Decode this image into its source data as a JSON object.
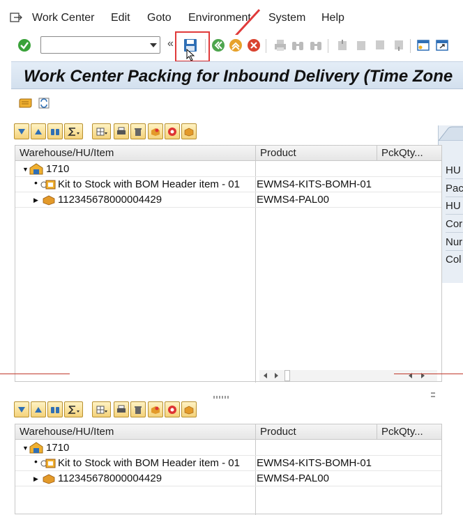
{
  "menu": {
    "items": [
      "Work Center",
      "Edit",
      "Goto",
      "Environment",
      "System",
      "Help"
    ]
  },
  "toolbar": {
    "command_field_value": "",
    "collapse_glyph": "«"
  },
  "title": "Work Center Packing for Inbound Delivery (Time Zone",
  "grid_columns": {
    "col1": "Warehouse/HU/Item",
    "col2": "Product",
    "col3": "PckQty...",
    "col3_bottom": "PckQty..."
  },
  "top_grid": {
    "rows": [
      {
        "name": "1710",
        "product": ""
      },
      {
        "name": "Kit to Stock with BOM Header item - 01",
        "product": "EWMS4-KITS-BOMH-01"
      },
      {
        "name": "112345678000004429",
        "product": "EWMS4-PAL00"
      }
    ]
  },
  "bottom_grid": {
    "rows": [
      {
        "name": "1710",
        "product": ""
      },
      {
        "name": "Kit to Stock with BOM Header item - 01",
        "product": "EWMS4-KITS-BOMH-01"
      },
      {
        "name": "112345678000004429",
        "product": "EWMS4-PAL00"
      }
    ]
  },
  "side_panel": {
    "labels": [
      "HU",
      "Pac",
      "HU",
      "Cor",
      "Nur",
      "Col"
    ]
  },
  "colors": {
    "title_band": "#d9e5f2",
    "highlight_box": "#e03a3a",
    "button_gold": "#f4d27a"
  }
}
